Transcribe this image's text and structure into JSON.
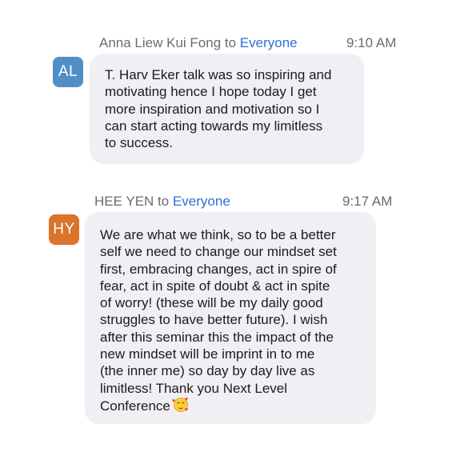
{
  "messages": [
    {
      "sender": "Anna Liew Kui Fong",
      "to_word": " to ",
      "recipient": "Everyone",
      "time": "9:10 AM",
      "initials": "AL",
      "avatar_color": "#4f8fc6",
      "lines": [
        "T. Harv Eker talk was so inspiring and",
        "motivating hence I hope today I get",
        "more inspiration and motivation so I",
        "can start acting towards my limitless",
        "to success."
      ]
    },
    {
      "sender": "HEE YEN",
      "to_word": " to ",
      "recipient": "Everyone",
      "time": "9:17 AM",
      "initials": "HY",
      "avatar_color": "#d9742a",
      "lines": [
        "We are what we think, so to be a better",
        "self we need to change our mindset set",
        "first, embracing changes, act in spire of",
        "fear, act in spite of doubt & act in spite",
        "of worry! (these will be my daily good",
        "struggles to have better future). I wish",
        "after this seminar this the impact of the",
        "new mindset will be imprint in to me",
        "(the inner me) so day by day live as",
        "limitless! Thank you Next Level",
        "Conference"
      ],
      "emoji_icon": "smiling-face-with-hearts-icon"
    }
  ]
}
